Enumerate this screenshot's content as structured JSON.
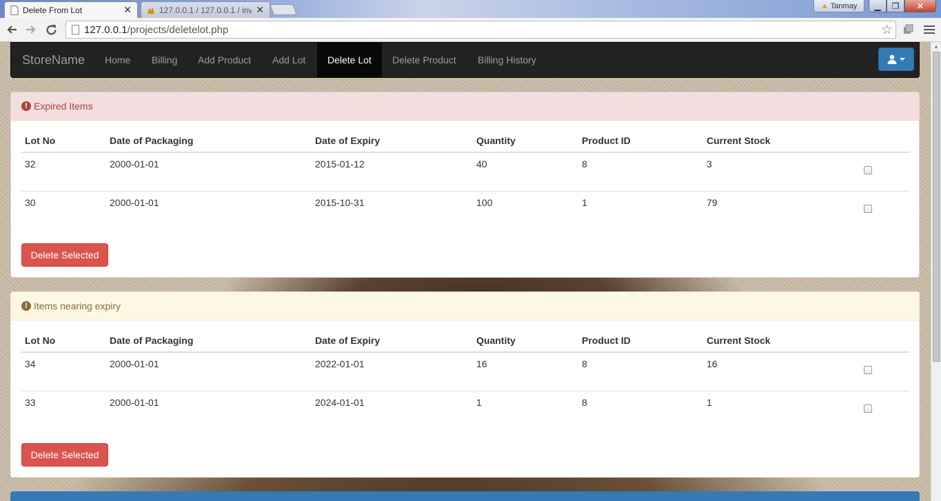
{
  "browser": {
    "tabs": [
      {
        "title": "Delete From Lot",
        "active": true
      },
      {
        "title": "127.0.0.1 / 127.0.0.1 / inve",
        "active": false
      }
    ],
    "profile_name": "Tanmay",
    "url_host": "127.0.0.1",
    "url_path": "/projects/deletelot.php"
  },
  "navbar": {
    "brand": "StoreName",
    "links": [
      "Home",
      "Billing",
      "Add Product",
      "Add Lot",
      "Delete Lot",
      "Delete Product",
      "Billing History"
    ],
    "active_link": "Delete Lot"
  },
  "columns": [
    "Lot No",
    "Date of Packaging",
    "Date of Expiry",
    "Quantity",
    "Product ID",
    "Current Stock"
  ],
  "expired": {
    "heading": "Expired Items",
    "rows": [
      {
        "lot_no": "32",
        "packaging": "2000-01-01",
        "expiry": "2015-01-12",
        "quantity": "40",
        "product_id": "8",
        "stock": "3"
      },
      {
        "lot_no": "30",
        "packaging": "2000-01-01",
        "expiry": "2015-10-31",
        "quantity": "100",
        "product_id": "1",
        "stock": "79"
      }
    ],
    "button_label": "Delete Selected"
  },
  "nearing": {
    "heading": "Items nearing expiry",
    "rows": [
      {
        "lot_no": "34",
        "packaging": "2000-01-01",
        "expiry": "2022-01-01",
        "quantity": "16",
        "product_id": "8",
        "stock": "16"
      },
      {
        "lot_no": "33",
        "packaging": "2000-01-01",
        "expiry": "2024-01-01",
        "quantity": "1",
        "product_id": "8",
        "stock": "1"
      }
    ],
    "button_label": "Delete Selected"
  },
  "colors": {
    "navbar": "#222222",
    "danger_button": "#d9534f",
    "danger_panel_heading": "#f2dede",
    "warning_panel_heading": "#fcf8e3",
    "primary": "#337ab7"
  }
}
